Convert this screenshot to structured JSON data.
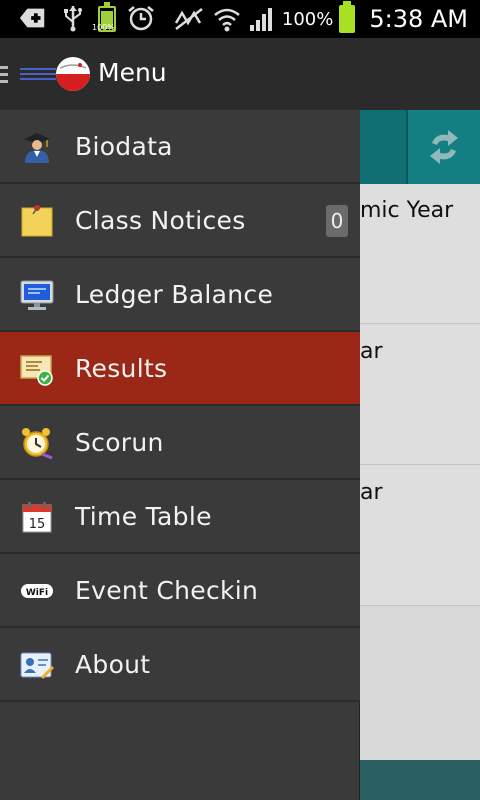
{
  "status_bar": {
    "battery_small_percent": "100%",
    "battery_percent": "100%",
    "time": "5:38 AM"
  },
  "header": {
    "title": "Menu"
  },
  "background": {
    "row_1_text": "mic Year",
    "row_2_text": "ar",
    "row_3_text": "ar"
  },
  "menu": {
    "items": [
      {
        "label": "Biodata",
        "icon": "student-icon"
      },
      {
        "label": "Class Notices",
        "icon": "sticky-note-icon",
        "badge": "0"
      },
      {
        "label": "Ledger Balance",
        "icon": "monitor-icon"
      },
      {
        "label": "Results",
        "icon": "certificate-icon",
        "active": true
      },
      {
        "label": "Scorun",
        "icon": "alarm-clock-icon"
      },
      {
        "label": "Time Table",
        "icon": "calendar-icon"
      },
      {
        "label": "Event Checkin",
        "icon": "wifi-icon"
      },
      {
        "label": "About",
        "icon": "id-card-icon"
      }
    ],
    "calendar_day": "15",
    "wifi_text": "WiFi"
  },
  "colors": {
    "active_item": "#9b2717",
    "drawer_bg": "#3a3a3a",
    "toolbar_teal": "#0f6f72"
  }
}
